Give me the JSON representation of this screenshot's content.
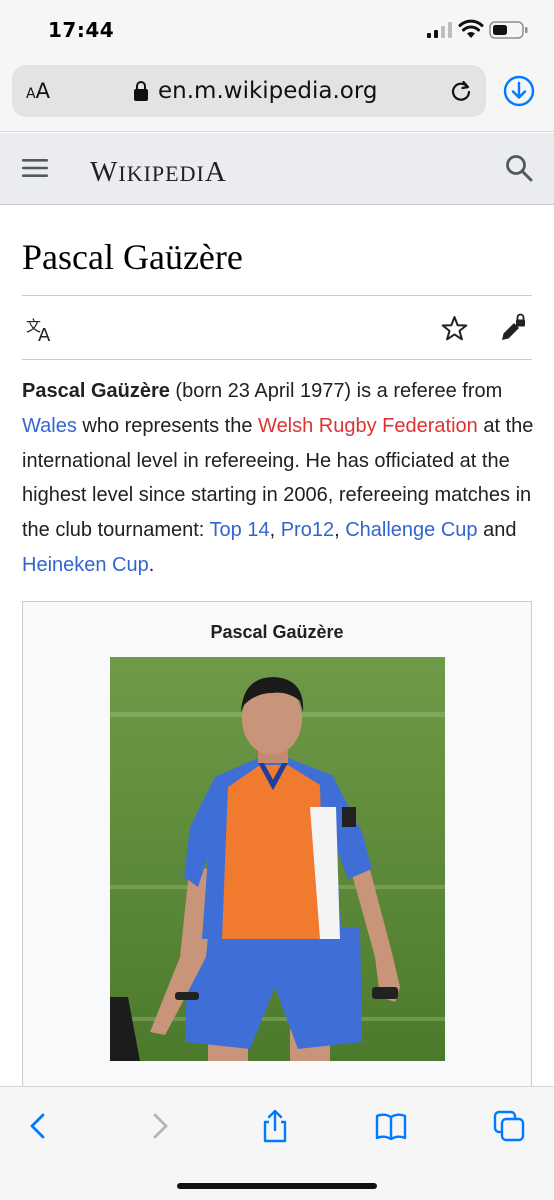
{
  "status_bar": {
    "time": "17:44"
  },
  "browser": {
    "text_size_label": "AA",
    "url": "en.m.wikipedia.org"
  },
  "header": {
    "wordmark": "Wikipedia"
  },
  "article": {
    "title": "Pascal Gaüzère",
    "intro": {
      "subject": "Pascal Gaüzère",
      "t1": " (born 23 April 1977) is a referee from ",
      "link_wales": "Wales",
      "t2": " who represents the ",
      "link_federation": "Welsh Rugby Federation",
      "t3": " at the international level in refereeing. He has officiated at the highest level since starting in 2006, refereeing matches in the club tournament: ",
      "link_top14": "Top 14",
      "sep1": ", ",
      "link_pro12": "Pro12",
      "sep2": ", ",
      "link_challenge": "Challenge Cup",
      "t4": " and ",
      "link_heineken": "Heineken Cup",
      "t5": "."
    },
    "infobox": {
      "title": "Pascal Gaüzère"
    }
  },
  "colors": {
    "link": "#3366cc",
    "redlink": "#dd3333",
    "accent": "#007aff"
  },
  "icons": {
    "lock": "lock-icon",
    "reload": "reload-icon",
    "download": "download-icon",
    "menu": "hamburger-icon",
    "search": "search-icon",
    "translate": "translate-icon",
    "watch": "star-icon",
    "edit": "edit-lock-icon",
    "back": "chevron-left-icon",
    "forward": "chevron-right-icon",
    "share": "share-icon",
    "bookmarks": "book-icon",
    "tabs": "tabs-icon"
  }
}
